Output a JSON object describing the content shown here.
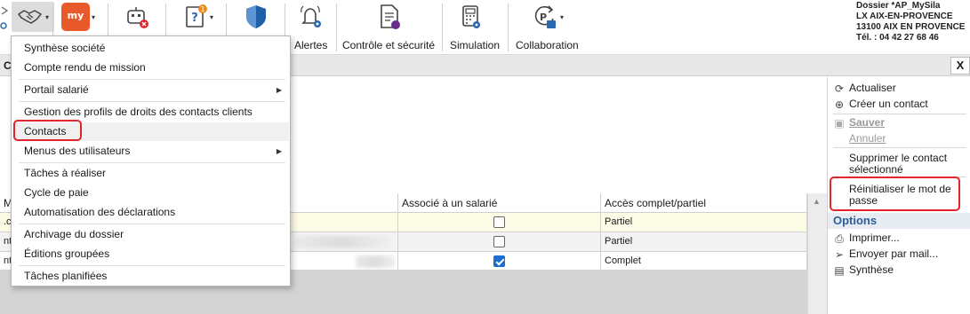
{
  "ribbon": {
    "labels": {
      "alertes": "Alertes",
      "controle": "Contrôle et sécurité",
      "simulation": "Simulation",
      "collaboration": "Collaboration"
    },
    "myee_text": "my ee",
    "help_badge": "1"
  },
  "company": {
    "line1": "Dossier *AP_MySila",
    "line2": "LX AIX-EN-PROVENCE",
    "line3": "13100 AIX EN PROVENCE",
    "line4": "Tél. : 04 42 27 68 46"
  },
  "window": {
    "tab_letter": "C",
    "close_label": "X"
  },
  "menu": {
    "items": [
      {
        "label": "Synthèse société"
      },
      {
        "label": "Compte rendu de mission"
      },
      {
        "label": "Portail salarié"
      },
      {
        "label": "Gestion des profils de droits des contacts clients"
      },
      {
        "label": "Contacts"
      },
      {
        "label": "Menus des utilisateurs"
      },
      {
        "label": "Tâches à réaliser"
      },
      {
        "label": "Cycle de paie"
      },
      {
        "label": "Automatisation des déclarations"
      },
      {
        "label": "Archivage du dossier"
      },
      {
        "label": "Éditions groupées"
      },
      {
        "label": "Tâches planifiées"
      }
    ]
  },
  "grid": {
    "columns": [
      "M",
      "Associé à un salarié",
      "Accès complet/partiel"
    ],
    "rows": [
      {
        "first": ".c",
        "associe": false,
        "acces": "Partiel"
      },
      {
        "first": "ntl",
        "associe": false,
        "acces": "Partiel"
      },
      {
        "first": "ntl",
        "associe": true,
        "acces": "Complet"
      }
    ]
  },
  "panel": {
    "actualiser": "Actualiser",
    "creer": "Créer un contact",
    "sauver": "Sauver",
    "annuler": "Annuler",
    "supprimer_1": "Supprimer le contact",
    "supprimer_2": "sélectionné",
    "reinit_1": "Réinitialiser le mot de",
    "reinit_2": "passe",
    "options": "Options",
    "imprimer": "Imprimer...",
    "envoyer": "Envoyer par mail...",
    "synthese": "Synthèse"
  },
  "colors": {
    "accent_red": "#e2262c",
    "options_blue": "#2f5d96",
    "check_blue": "#1c6fd1",
    "row_yellow": "#fcfbe6"
  }
}
